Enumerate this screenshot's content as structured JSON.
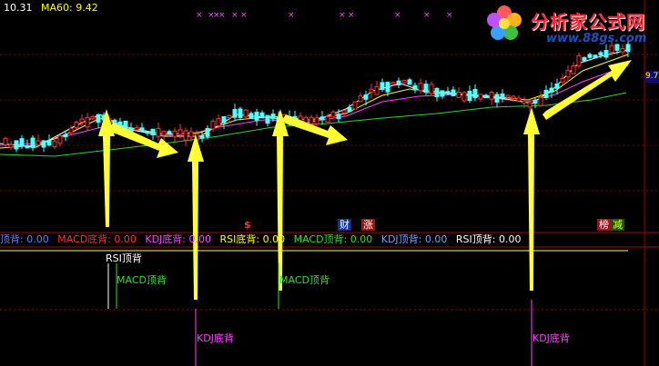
{
  "header": {
    "ma_labels": [
      {
        "text": "10.31",
        "color": "#ffffff"
      },
      {
        "text": "MA60: 9.42",
        "color": "#ffff00"
      }
    ],
    "right_price": "9.7"
  },
  "logo": {
    "title": "分析家公式网",
    "url": "www.88gs.com"
  },
  "event_tags": {
    "s_tag": "$",
    "cai": "财",
    "zhang": "涨",
    "bang": "榜",
    "jian": "减"
  },
  "indicator_line": {
    "items": [
      {
        "text": "顶背: 0.00",
        "color": "#4f86ff"
      },
      {
        "text": "MACD底背: 0.00",
        "color": "#ff3030"
      },
      {
        "text": "KDJ底背: 0.00",
        "color": "#ff40ff"
      },
      {
        "text": "RSI底背: 0.00",
        "color": "#ffff00"
      },
      {
        "text": "MACD顶背: 0.00",
        "color": "#33dd33"
      },
      {
        "text": "KDJ顶背: 0.00",
        "color": "#6aa6ff"
      },
      {
        "text": "RSI顶背: 0.00",
        "color": "#ffffff"
      }
    ]
  },
  "signals": {
    "rsi_top": "RSI顶背",
    "macd_top_1": "MACD顶背",
    "macd_top_2": "MACD顶背",
    "kdj_bottom_1": "KDJ底背",
    "kdj_bottom_2": "KDJ底背"
  },
  "colors": {
    "bg": "#000000",
    "up": "#ff3232",
    "down": "#54ffff",
    "ma_white": "#ffffff",
    "ma_yellow": "#ffff00",
    "ma_magenta": "#ff40ff",
    "ma_green": "#22dd22",
    "arrow": "#ffff33",
    "grid": "#7a0000"
  }
}
